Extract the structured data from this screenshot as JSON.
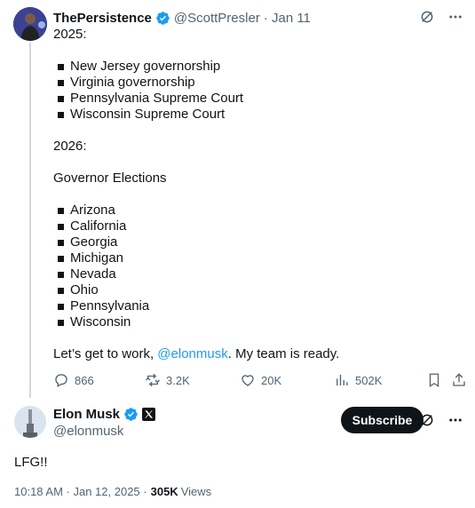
{
  "parent": {
    "name": "ThePersistence",
    "handle": "@ScottPresler",
    "date": "· Jan 11",
    "body": {
      "line1": "2025:",
      "list2025": [
        "New Jersey governorship",
        "Virginia governorship",
        "Pennsylvania Supreme Court",
        "Wisconsin Supreme Court"
      ],
      "line2": "2026:",
      "line3": "Governor Elections",
      "list2026": [
        "Arizona",
        "California",
        "Georgia",
        "Michigan",
        "Nevada",
        "Ohio",
        "Pennsylvania",
        "Wisconsin"
      ],
      "closing_pre": "Let’s get to work, ",
      "closing_link": "@elonmusk",
      "closing_post": ". My team is ready."
    },
    "metrics": {
      "replies": "866",
      "reposts": "3.2K",
      "likes": "20K",
      "views": "502K"
    }
  },
  "reply": {
    "name": "Elon Musk",
    "handle": "@elonmusk",
    "subscribe_label": "Subscribe",
    "text": "LFG!!",
    "timestamp": "10:18 AM · Jan 12, 2025 · ",
    "views_count": "305K",
    "views_label": "Views"
  },
  "colors": {
    "accent": "#1d9bf0",
    "text": "#0f1419",
    "muted": "#536471"
  }
}
